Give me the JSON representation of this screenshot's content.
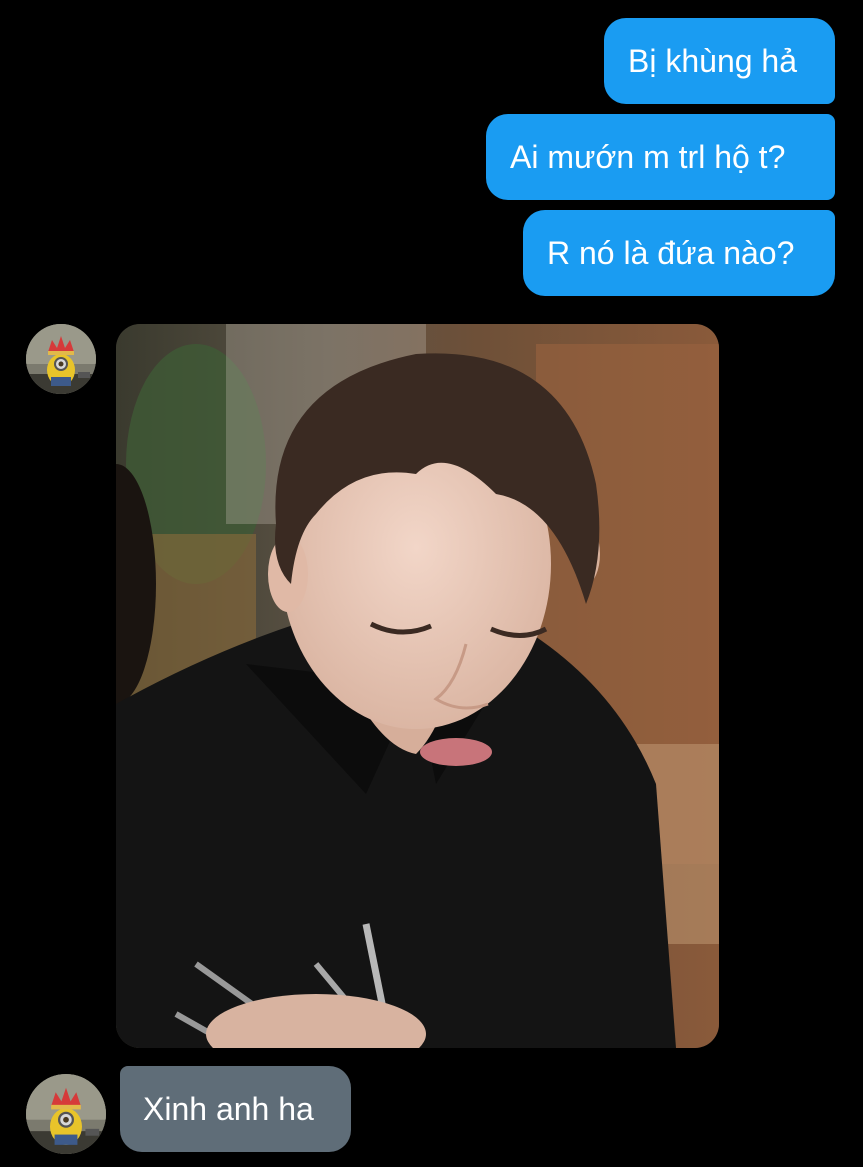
{
  "messages": {
    "sent": [
      {
        "text": "Bị khùng hả"
      },
      {
        "text": "Ai mướn m trl hộ t?"
      },
      {
        "text": "R nó là đứa nào?"
      }
    ],
    "received_text": "Xinh anh ha"
  },
  "avatar_icon": "minion-king-avatar",
  "photo_icon": "photo-young-man-black-polo-eating",
  "colors": {
    "background": "#000000",
    "sent_bubble": "#1a9cf2",
    "received_bubble": "#5f6d78",
    "text": "#ffffff"
  }
}
